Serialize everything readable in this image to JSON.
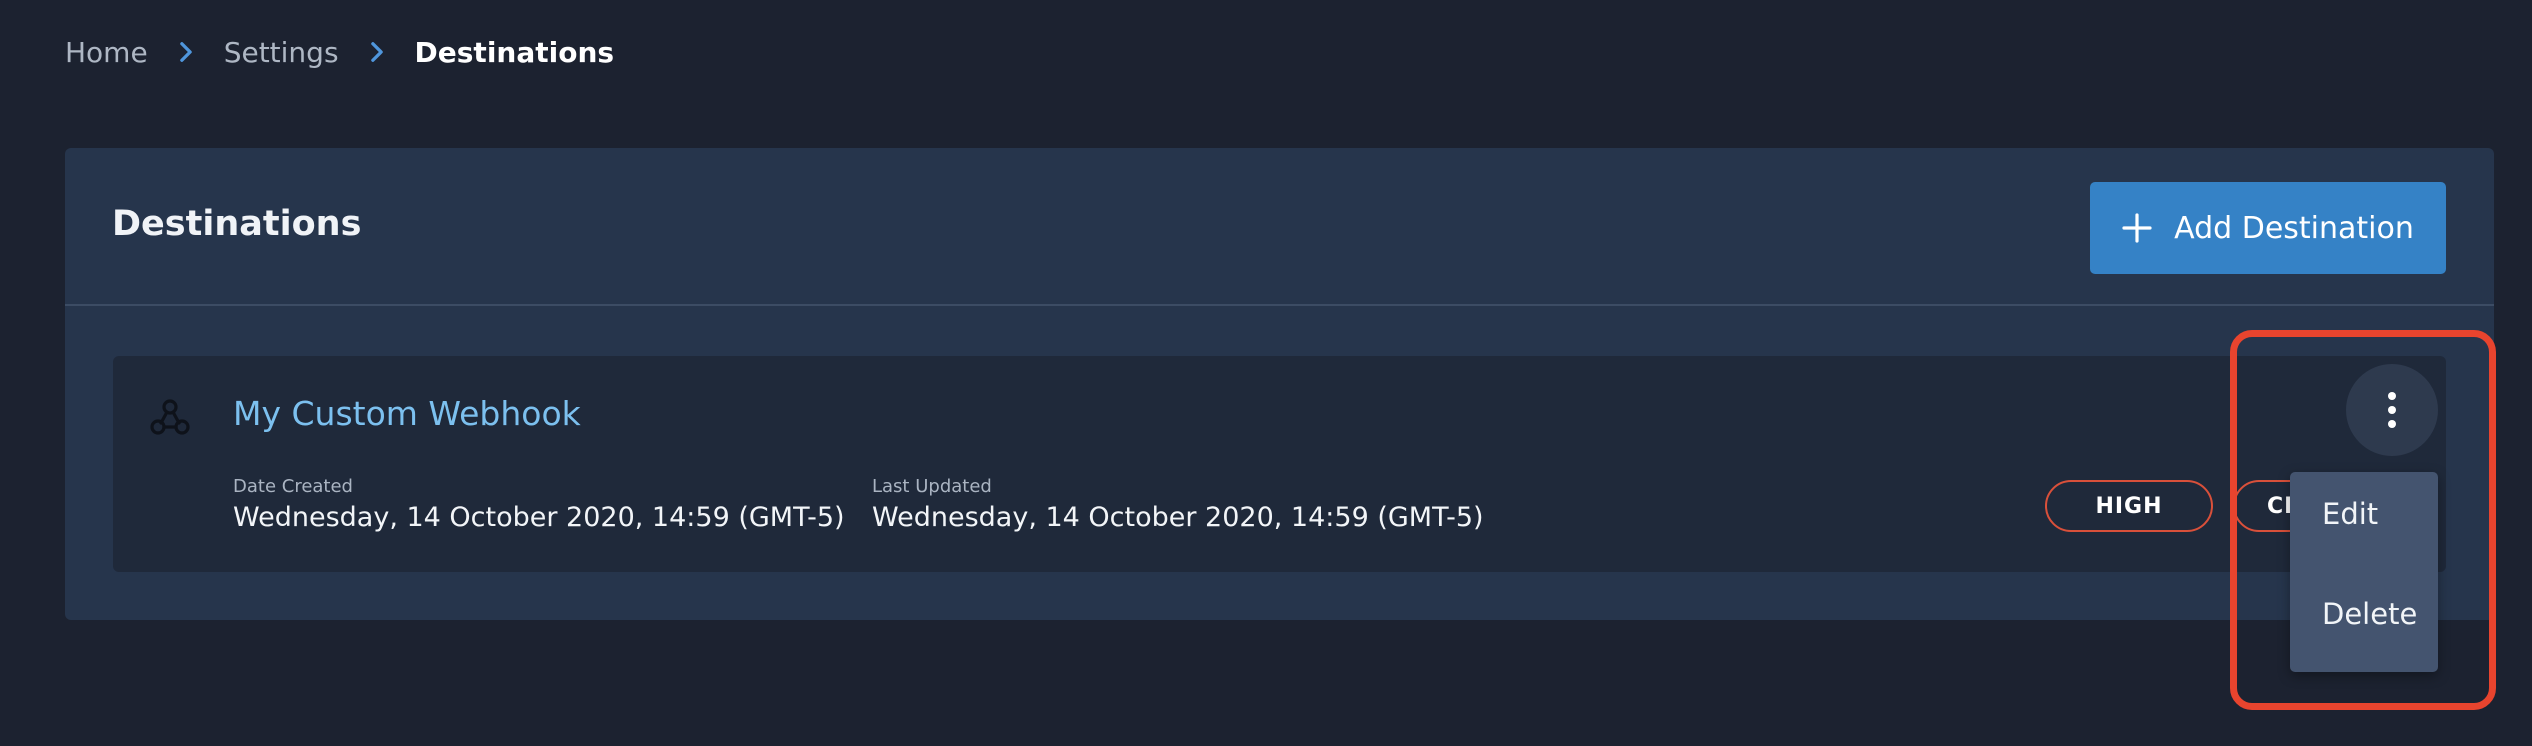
{
  "breadcrumb": {
    "items": [
      "Home",
      "Settings",
      "Destinations"
    ]
  },
  "panel": {
    "title": "Destinations",
    "add_button_label": "Add Destination"
  },
  "destination": {
    "name": "My Custom Webhook",
    "date_created_label": "Date Created",
    "date_created": "Wednesday, 14 October 2020, 14:59 (GMT-5)",
    "last_updated_label": "Last Updated",
    "last_updated": "Wednesday, 14 October 2020, 14:59 (GMT-5)",
    "tags": [
      "HIGH",
      "CR"
    ]
  },
  "menu": {
    "items": [
      "Edit",
      "Delete"
    ]
  },
  "colors": {
    "background": "#1c2230",
    "panel": "#26354c",
    "accent": "#3582c6",
    "link": "#7cc0ef",
    "tag_border": "#d9503a",
    "highlight": "#e8442e"
  },
  "icons": {
    "breadcrumb_separator": "chevron-right-icon",
    "add": "plus-icon",
    "destination": "webhook-icon",
    "actions": "kebab-menu-icon"
  }
}
